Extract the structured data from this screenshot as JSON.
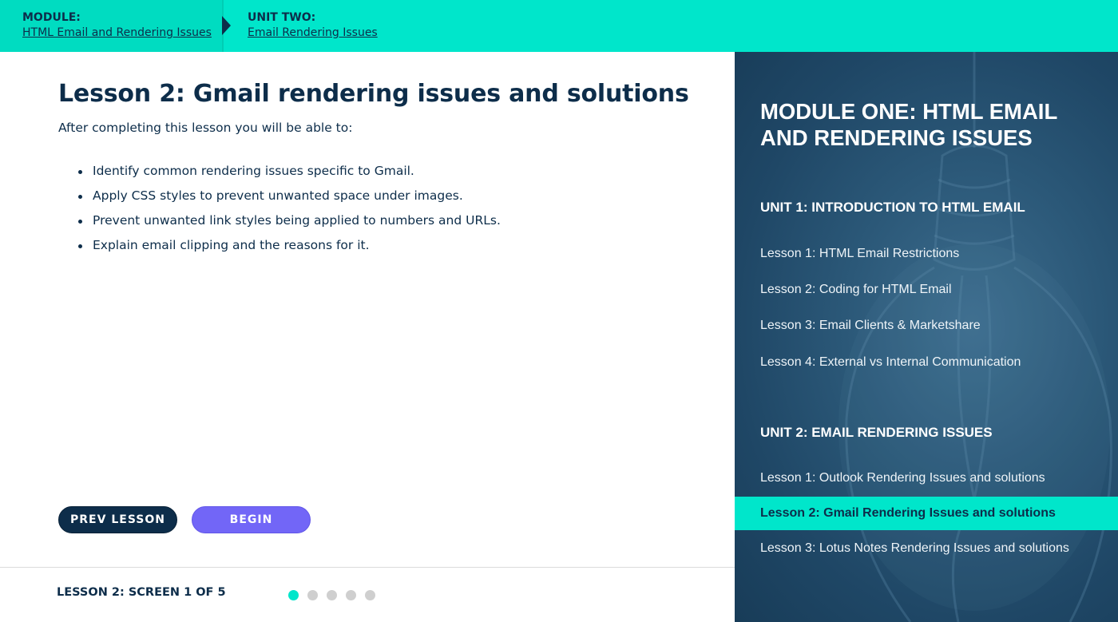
{
  "breadcrumb": {
    "module_heading": "MODULE:",
    "module_link": "HTML Email and Rendering Issues",
    "unit_heading": "UNIT TWO:",
    "unit_link": "Email Rendering Issues"
  },
  "lesson": {
    "title": "Lesson 2: Gmail rendering issues and solutions",
    "intro": "After completing this lesson you will be able to:",
    "objectives": [
      "Identify common rendering issues specific to Gmail.",
      "Apply CSS styles to prevent unwanted space under images.",
      "Prevent unwanted link styles being applied to numbers and URLs.",
      "Explain email clipping and the reasons for it."
    ]
  },
  "buttons": {
    "prev_label": "PREV LESSON",
    "begin_label": "BEGIN"
  },
  "progress": {
    "label": "LESSON 2: SCREEN 1 OF 5",
    "current_screen": 1,
    "total_screens": 5
  },
  "sidebar": {
    "module_title": "MODULE ONE: HTML EMAIL AND RENDERING ISSUES",
    "units": [
      {
        "heading": "UNIT 1: INTRODUCTION TO HTML EMAIL",
        "lessons": [
          "Lesson 1: HTML Email Restrictions",
          "Lesson 2: Coding for HTML Email",
          "Lesson 3: Email Clients & Marketshare",
          "Lesson 4: External vs Internal Communication"
        ]
      },
      {
        "heading": "UNIT 2: EMAIL RENDERING ISSUES",
        "lessons": [
          "Lesson 1: Outlook Rendering Issues and solutions",
          "Lesson 2: Gmail Rendering Issues and solutions",
          "Lesson 3: Lotus Notes Rendering Issues and solutions"
        ]
      }
    ]
  },
  "colors": {
    "accent_teal": "#00e6cb",
    "navy": "#0d2d4a",
    "button_purple": "#7266f7",
    "sidebar_blue": "#2b5878"
  }
}
